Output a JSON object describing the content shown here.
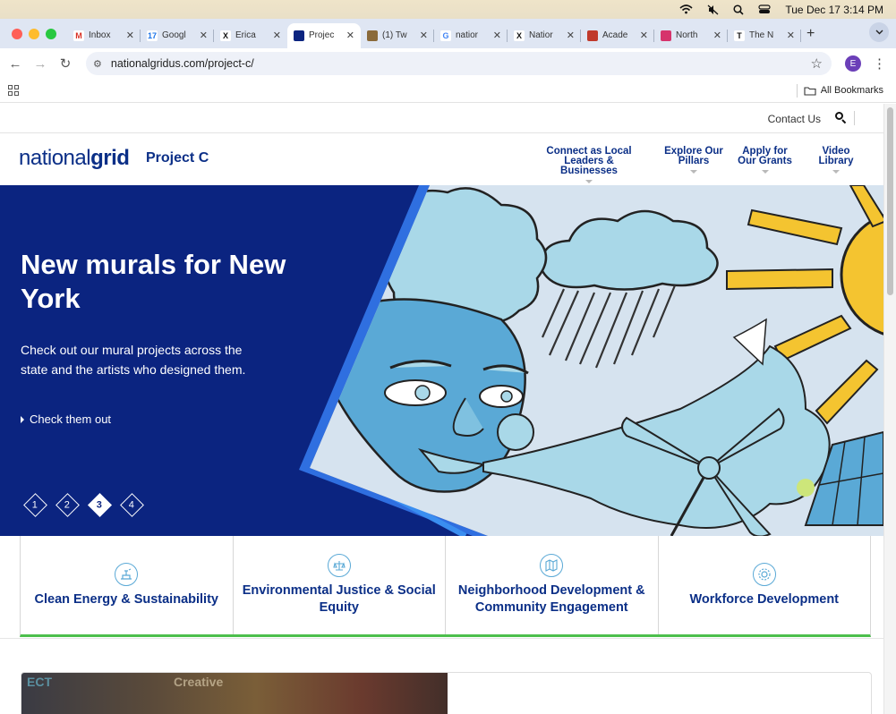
{
  "menubar": {
    "datetime": "Tue Dec 17  3:14 PM"
  },
  "browser": {
    "tabs": [
      {
        "title": "Inbox",
        "fav_letter": "M",
        "fav_color": "#d93025",
        "active": false
      },
      {
        "title": "Googl",
        "fav_letter": "17",
        "fav_color": "#1a73e8",
        "active": false
      },
      {
        "title": "Erica",
        "fav_letter": "X",
        "fav_color": "#111111",
        "active": false
      },
      {
        "title": "Projec",
        "fav_letter": "",
        "fav_color": "#0b2480",
        "active": true
      },
      {
        "title": "(1) Tw",
        "fav_letter": "",
        "fav_color": "#8a6a3a",
        "active": false
      },
      {
        "title": "natior",
        "fav_letter": "G",
        "fav_color": "#4285f4",
        "active": false
      },
      {
        "title": "Natior",
        "fav_letter": "X",
        "fav_color": "#111111",
        "active": false
      },
      {
        "title": "Acade",
        "fav_letter": "",
        "fav_color": "#c0392b",
        "active": false
      },
      {
        "title": "North",
        "fav_letter": "",
        "fav_color": "#d6336c",
        "active": false
      },
      {
        "title": "The N",
        "fav_letter": "T",
        "fav_color": "#111111",
        "active": false
      }
    ],
    "url": "nationalgridus.com/project-c/",
    "profile_initial": "E",
    "all_bookmarks": "All Bookmarks"
  },
  "site": {
    "contact": "Contact Us",
    "logo_light": "national",
    "logo_bold": "grid",
    "project": "Project C",
    "nav": [
      {
        "line1": "Connect as Local",
        "line2": "Leaders & Businesses"
      },
      {
        "line1": "Explore Our",
        "line2": "Pillars"
      },
      {
        "line1": "Apply for",
        "line2": "Our Grants"
      },
      {
        "line1": "Video",
        "line2": "Library"
      }
    ],
    "hero": {
      "title": "New murals for New York",
      "subtitle": "Check out our mural projects across the state and the artists who designed them.",
      "cta": "Check them out",
      "dots": [
        "1",
        "2",
        "3",
        "4"
      ],
      "active_dot": 3
    },
    "pillars": [
      {
        "label": "Clean Energy & Sustainability",
        "icon": "clean-energy-icon"
      },
      {
        "label": "Environmental Justice & Social Equity",
        "icon": "justice-icon"
      },
      {
        "label": "Neighborhood Development & Community Engagement",
        "icon": "map-icon"
      },
      {
        "label": "Workforce Development",
        "icon": "gear-icon"
      }
    ],
    "colors": {
      "brand": "#0b2480",
      "accent_green": "#4cbf4c",
      "mural_sky": "#cfe2f1",
      "mural_face": "#5aa9d6",
      "sun": "#f4c430"
    }
  }
}
